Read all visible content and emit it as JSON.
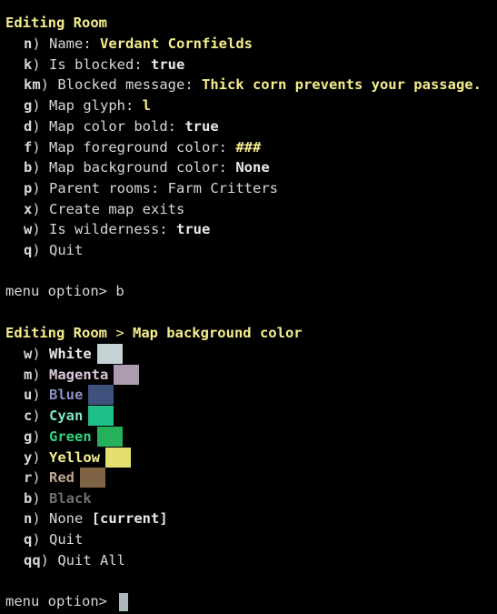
{
  "editing_menu": {
    "title": "Editing Room",
    "options": [
      {
        "key": "n",
        "label": "Name: ",
        "value": "Verdant Cornfields",
        "value_style": "yellow"
      },
      {
        "key": "k",
        "label": "Is blocked: ",
        "value": "true",
        "value_style": "bold"
      },
      {
        "key": "km",
        "label": "Blocked message: ",
        "value": "Thick corn prevents your passage.",
        "value_style": "yellow"
      },
      {
        "key": "g",
        "label": "Map glyph: ",
        "value": "l",
        "value_style": "yellow"
      },
      {
        "key": "d",
        "label": "Map color bold: ",
        "value": "true",
        "value_style": "bold"
      },
      {
        "key": "f",
        "label": "Map foreground color: ",
        "value": "###",
        "value_style": "yellow"
      },
      {
        "key": "b",
        "label": "Map background color: ",
        "value": "None",
        "value_style": "bold"
      },
      {
        "key": "p",
        "label": "Parent rooms: ",
        "value": "Farm Critters",
        "value_style": "plain"
      },
      {
        "key": "x",
        "label": "Create map exits",
        "value": "",
        "value_style": "plain"
      },
      {
        "key": "w",
        "label": "Is wilderness: ",
        "value": "true",
        "value_style": "bold"
      },
      {
        "key": "q",
        "label": "Quit",
        "value": "",
        "value_style": "plain"
      }
    ]
  },
  "prompt1": {
    "text": "menu option> ",
    "input": "b"
  },
  "color_menu": {
    "title_part1": "Editing Room",
    "separator": " > ",
    "title_part2": "Map background color",
    "options": [
      {
        "key": "w",
        "label": "White",
        "color": "#e8e8e8",
        "swatch": "#c5d3d6"
      },
      {
        "key": "m",
        "label": "Magenta",
        "color": "#d9c7d9",
        "swatch": "#ad9bb0"
      },
      {
        "key": "u",
        "label": "Blue",
        "color": "#8c90c8",
        "swatch": "#3f527e"
      },
      {
        "key": "c",
        "label": "Cyan",
        "color": "#7fe3c9",
        "swatch": "#1fbf8a"
      },
      {
        "key": "g",
        "label": "Green",
        "color": "#33d27e",
        "swatch": "#25b05b"
      },
      {
        "key": "y",
        "label": "Yellow",
        "color": "#f4ec8e",
        "swatch": "#e3df71"
      },
      {
        "key": "r",
        "label": "Red",
        "color": "#bba58d",
        "swatch": "#7e6445"
      },
      {
        "key": "b",
        "label": "Black",
        "color": "#6f6f6f",
        "swatch": ""
      }
    ],
    "none_option": {
      "key": "n",
      "label": "None ",
      "tag": "[current]"
    },
    "quit_option": {
      "key": "q",
      "label": "Quit"
    },
    "quit_all_option": {
      "key": "qq",
      "label": "Quit All"
    }
  },
  "prompt2": {
    "text": "menu option> "
  }
}
